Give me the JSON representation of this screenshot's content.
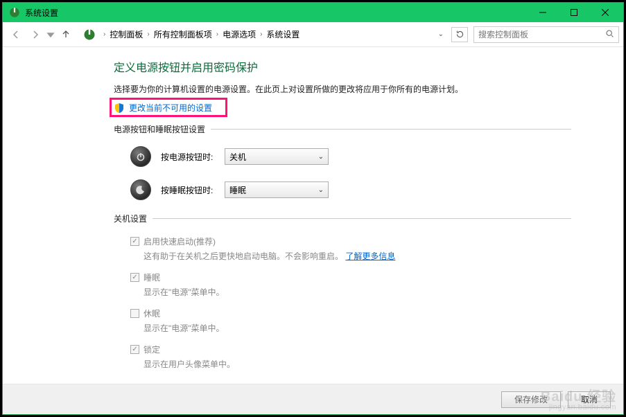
{
  "window": {
    "title": "系统设置"
  },
  "breadcrumb": {
    "items": [
      "控制面板",
      "所有控制面板项",
      "电源选项",
      "系统设置"
    ]
  },
  "search": {
    "placeholder": "搜索控制面板"
  },
  "main": {
    "heading": "定义电源按钮并启用密码保护",
    "description": "选择要为你的计算机设置的电源设置。在此页上对设置所做的更改将应用于你所有的电源计划。",
    "change_link": "更改当前不可用的设置",
    "button_section_label": "电源按钮和睡眠按钮设置",
    "power_button_label": "按电源按钮时:",
    "power_button_value": "关机",
    "sleep_button_label": "按睡眠按钮时:",
    "sleep_button_value": "睡眠",
    "shutdown_section_label": "关机设置",
    "options": [
      {
        "title": "启用快速启动(推荐)",
        "sub": "这有助于在关机之后更快地启动电脑。不会影响重启。",
        "link": "了解更多信息",
        "checked": true
      },
      {
        "title": "睡眠",
        "sub": "显示在\"电源\"菜单中。",
        "checked": true
      },
      {
        "title": "休眠",
        "sub": "显示在\"电源\"菜单中。",
        "checked": false
      },
      {
        "title": "锁定",
        "sub": "显示在用户头像菜单中。",
        "checked": true
      }
    ]
  },
  "footer": {
    "save": "保存修改",
    "cancel": "取消"
  },
  "watermark": {
    "brand": "Baidu 经验",
    "url": "jingyan.baidu.com"
  }
}
